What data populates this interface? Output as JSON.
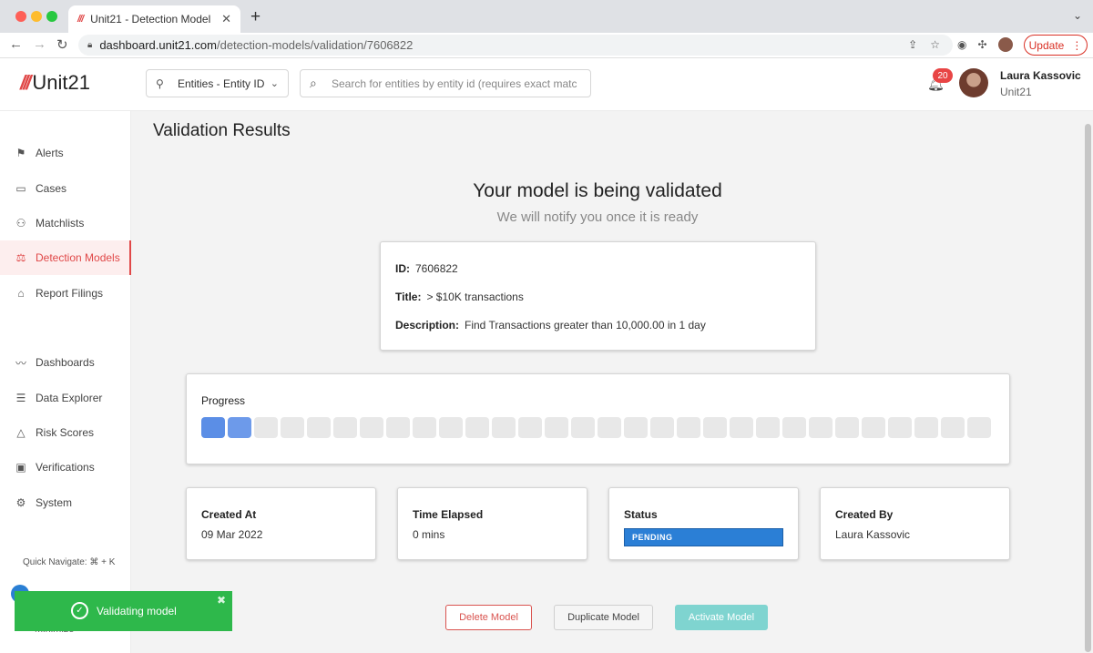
{
  "browser": {
    "tab_title": "Unit21 - Detection Model",
    "tab_close": "✕",
    "new_tab": "+",
    "url_host": "dashboard.unit21.com",
    "url_path": "/detection-models/validation/7606822",
    "update_label": "Update",
    "tabs_menu": "⌄"
  },
  "header": {
    "logo_text": "Unit21",
    "entity_select_label": "Entities - Entity ID",
    "search_placeholder": "Search for entities by entity id (requires exact match)",
    "notification_count": "20",
    "user_name": "Laura Kassovic",
    "user_org": "Unit21"
  },
  "sidebar": {
    "items": [
      {
        "label": "Alerts",
        "icon": "flag-icon"
      },
      {
        "label": "Cases",
        "icon": "briefcase-icon"
      },
      {
        "label": "Matchlists",
        "icon": "user-x-icon"
      },
      {
        "label": "Detection Models",
        "icon": "scale-icon"
      },
      {
        "label": "Report Filings",
        "icon": "bank-icon"
      },
      {
        "label": "Dashboards",
        "icon": "line-chart-icon"
      },
      {
        "label": "Data Explorer",
        "icon": "search-list-icon"
      },
      {
        "label": "Risk Scores",
        "icon": "warning-icon"
      },
      {
        "label": "Verifications",
        "icon": "id-card-icon"
      },
      {
        "label": "System",
        "icon": "gear-icon"
      }
    ],
    "active": "Detection Models",
    "quick_navigate": "Quick Navigate: ⌘ + K",
    "minimize": "Minimize"
  },
  "main": {
    "page_title": "Validation Results",
    "headline": "Your model is being validated",
    "subline": "We will notify you once it is ready",
    "info": {
      "id_label": "ID:",
      "id_value": "7606822",
      "title_label": "Title:",
      "title_value": "> $10K transactions",
      "description_label": "Description:",
      "description_value": "Find Transactions greater than 10,000.00 in 1 day"
    },
    "progress": {
      "label": "Progress",
      "segments_total": 30,
      "segments_filled": 2
    },
    "stats": {
      "created_at_label": "Created At",
      "created_at_value": "09 Mar 2022",
      "time_elapsed_label": "Time Elapsed",
      "time_elapsed_value": "0 mins",
      "status_label": "Status",
      "status_value": "PENDING",
      "created_by_label": "Created By",
      "created_by_value": "Laura Kassovic"
    },
    "buttons": {
      "delete": "Delete Model",
      "duplicate": "Duplicate Model",
      "activate": "Activate Model"
    }
  },
  "toast": {
    "message": "Validating model",
    "close": "✖"
  },
  "colors": {
    "brand": "#e04848",
    "progress_filled": "#5b8ee6",
    "status_badge": "#2b7fd6",
    "toast_success": "#2eb84b",
    "activate_button": "#7fd4d0"
  }
}
